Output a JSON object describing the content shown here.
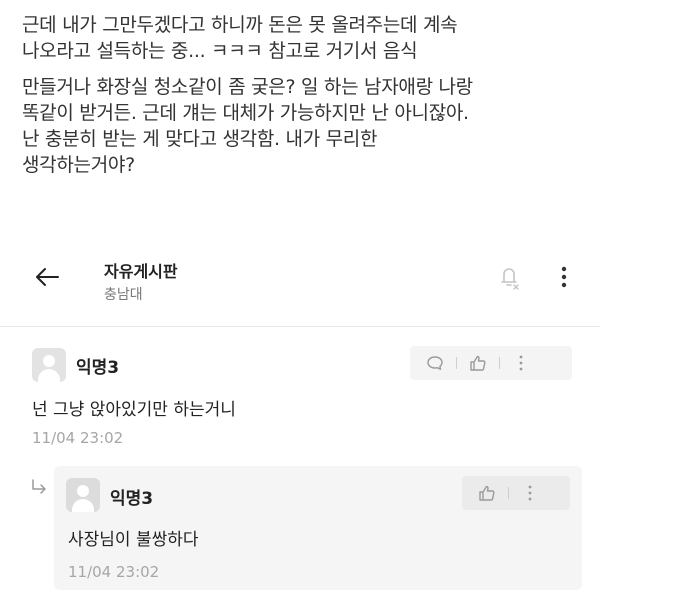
{
  "post": {
    "paragraph1_line1": "근데 내가 그만두겠다고 하니까 돈은 못 올려주는데 계속",
    "paragraph1_line2": "나오라고 설득하는 중... ㅋㅋㅋ 참고로 거기서 음식",
    "paragraph2_line1": "만들거나 화장실 청소같이 좀 궂은? 일 하는 남자애랑 나랑",
    "paragraph2_line2": "똑같이 받거든. 근데 걔는 대체가 가능하지만 난 아니잖아.",
    "paragraph2_line3": "난 충분히 받는 게 맞다고 생각함. 내가 무리한",
    "paragraph2_line4": "생각하는거야?"
  },
  "header": {
    "title": "자유게시판",
    "subtitle": "충남대",
    "icons": {
      "back": "arrow-left-icon",
      "notification": "bell-off-icon",
      "more": "more-vertical-icon"
    }
  },
  "comments": [
    {
      "author": "익명3",
      "text": "넌 그냥 앉아있기만 하는거니",
      "time": "11/04 23:02",
      "actions": [
        "reply-icon",
        "like-icon",
        "more-vertical-icon"
      ]
    }
  ],
  "replies": [
    {
      "author": "익명3",
      "text": "사장님이 불쌍하다",
      "time": "11/04 23:02",
      "actions": [
        "like-icon",
        "more-vertical-icon"
      ]
    }
  ],
  "colors": {
    "text_primary": "#222222",
    "text_secondary": "#777777",
    "timestamp": "#a6a6a6",
    "action_bg": "#f4f4f4",
    "reply_bg": "#f5f5f5",
    "avatar_bg": "#e3e3e3"
  }
}
